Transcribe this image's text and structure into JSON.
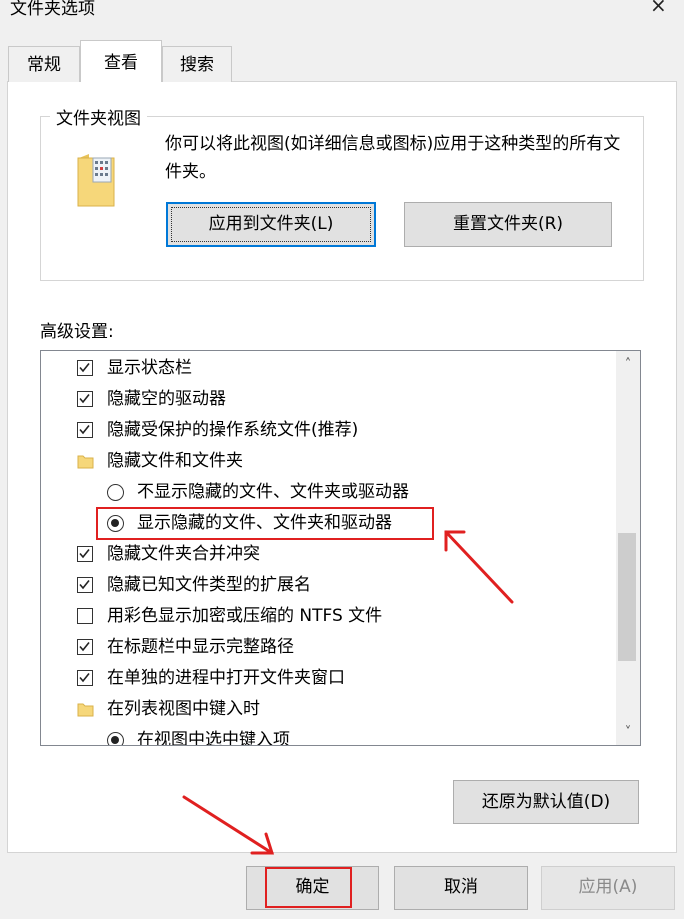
{
  "window": {
    "title": "文件夹选项",
    "close_icon": "×"
  },
  "tabs": [
    {
      "label": "常规",
      "selected": false
    },
    {
      "label": "查看",
      "selected": true
    },
    {
      "label": "搜索",
      "selected": false
    }
  ],
  "folder_views": {
    "group_title": "文件夹视图",
    "description": "你可以将此视图(如详细信息或图标)应用于这种类型的所有文件夹。",
    "apply_button": "应用到文件夹(L)",
    "reset_button": "重置文件夹(R)"
  },
  "advanced": {
    "label": "高级设置:",
    "items": [
      {
        "type": "checkbox",
        "checked": true,
        "label": "显示状态栏"
      },
      {
        "type": "checkbox",
        "checked": true,
        "label": "隐藏空的驱动器"
      },
      {
        "type": "checkbox",
        "checked": true,
        "label": "隐藏受保护的操作系统文件(推荐)"
      },
      {
        "type": "folder",
        "label": "隐藏文件和文件夹"
      },
      {
        "type": "radio",
        "selected": false,
        "label": "不显示隐藏的文件、文件夹或驱动器"
      },
      {
        "type": "radio",
        "selected": true,
        "label": "显示隐藏的文件、文件夹和驱动器"
      },
      {
        "type": "checkbox",
        "checked": true,
        "label": "隐藏文件夹合并冲突"
      },
      {
        "type": "checkbox",
        "checked": true,
        "label": "隐藏已知文件类型的扩展名"
      },
      {
        "type": "checkbox",
        "checked": false,
        "label": "用彩色显示加密或压缩的 NTFS 文件"
      },
      {
        "type": "checkbox",
        "checked": true,
        "label": "在标题栏中显示完整路径"
      },
      {
        "type": "checkbox",
        "checked": true,
        "label": "在单独的进程中打开文件夹窗口"
      },
      {
        "type": "folder",
        "label": "在列表视图中键入时"
      },
      {
        "type": "radio",
        "selected": true,
        "label": "在视图中选中键入项"
      }
    ],
    "restore_button": "还原为默认值(D)"
  },
  "footer": {
    "ok": "确定",
    "cancel": "取消",
    "apply": "应用(A)"
  },
  "colors": {
    "highlight": "#e02020",
    "focus": "#0078d7"
  }
}
